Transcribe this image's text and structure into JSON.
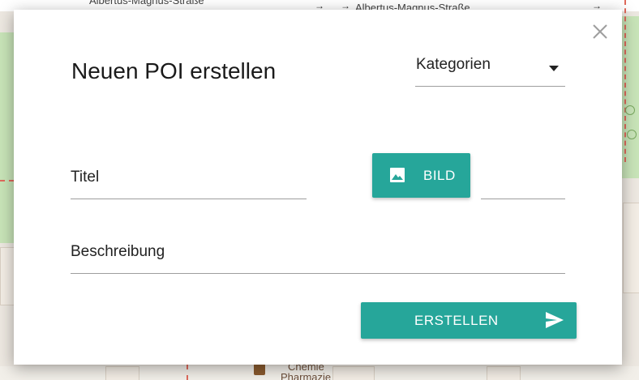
{
  "map": {
    "street_label_1": "Albertus-Magnus-Straße",
    "street_label_2": "Albertus-Magnus-Straße",
    "poi_label_1": "Chemie",
    "poi_label_2": "Pharmazie"
  },
  "dialog": {
    "title": "Neuen POI erstellen",
    "close_icon": "close-icon",
    "category_select": {
      "value": "Kategorien",
      "icon": "dropdown-arrow-icon"
    },
    "title_field": {
      "placeholder": "Titel",
      "value": ""
    },
    "image_button": {
      "label": "Bild",
      "icon": "image-icon"
    },
    "image_field": {
      "value": ""
    },
    "description_field": {
      "placeholder": "Beschreibung",
      "value": ""
    },
    "submit_button": {
      "label": "Erstellen",
      "icon": "send-icon"
    },
    "accent_color": "#26a69a"
  }
}
